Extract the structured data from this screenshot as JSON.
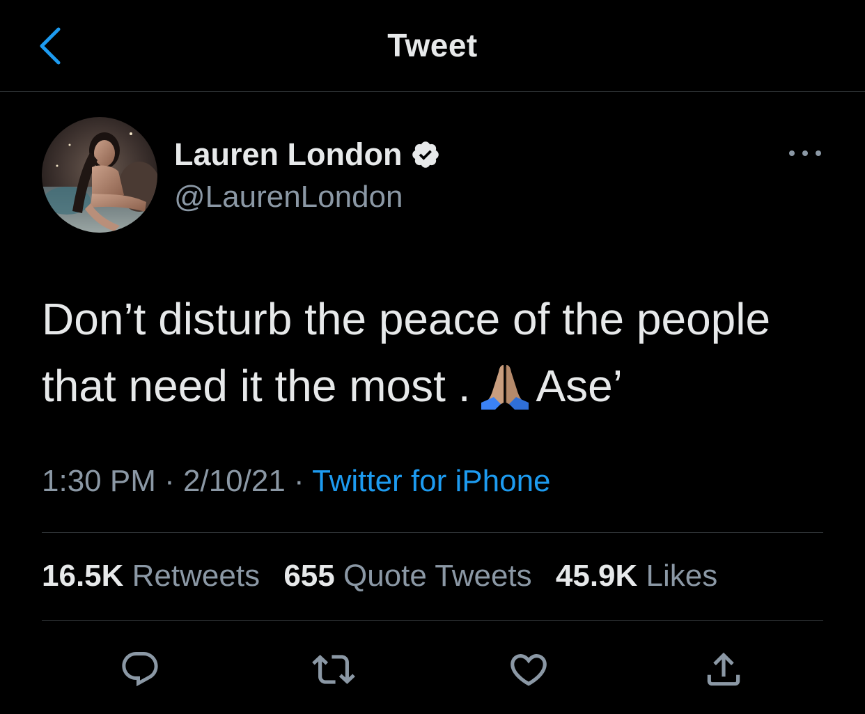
{
  "header": {
    "title": "Tweet",
    "back_icon": "chevron-left-icon"
  },
  "colors": {
    "background": "#000000",
    "accent": "#1d9bf0",
    "primary_text": "#e7e9ea",
    "secondary_text": "#8b98a5",
    "divider": "#2f3336"
  },
  "author": {
    "name": "Lauren London",
    "handle": "@LaurenLondon",
    "verified_icon": "verified-badge-icon",
    "avatar_icon": "avatar-photo"
  },
  "tweet": {
    "line1": "Don’t disturb the peace of the people",
    "line2_before": "that need it the most .",
    "emoji": "folded-hands-emoji",
    "line2_after": "Ase’"
  },
  "meta": {
    "time": "1:30 PM",
    "sep1": "·",
    "date": "2/10/21",
    "sep2": "·",
    "source": "Twitter for iPhone"
  },
  "stats": {
    "retweets_count": "16.5K",
    "retweets_label": "Retweets",
    "quotes_count": "655",
    "quotes_label": "Quote Tweets",
    "likes_count": "45.9K",
    "likes_label": "Likes"
  },
  "actions": {
    "reply_icon": "reply-icon",
    "retweet_icon": "retweet-icon",
    "like_icon": "heart-icon",
    "share_icon": "share-icon",
    "more_icon": "more-horizontal-icon"
  }
}
